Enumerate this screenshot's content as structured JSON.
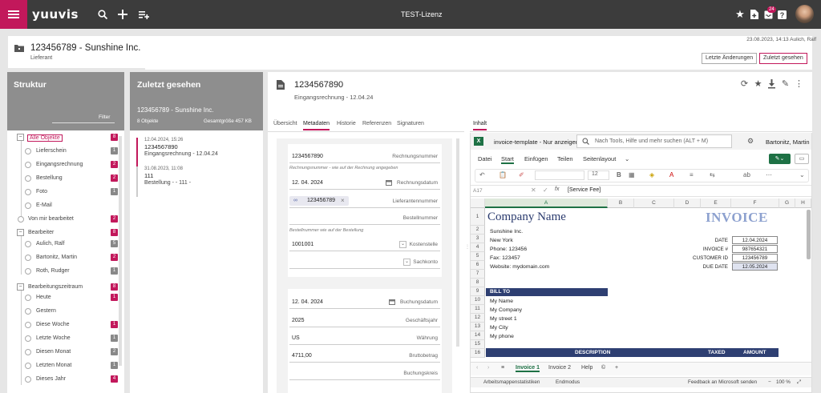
{
  "app": {
    "logo": "yuuvis",
    "title": "TEST-Lizenz",
    "notif_count": "24"
  },
  "header": {
    "object_title": "123456789 - Sunshine Inc.",
    "object_subtitle": "Lieferant",
    "meta": "23.08.2023, 14:13 Aulich, Ralf",
    "btn_recent_changes": "Letzte Änderungen",
    "btn_recently_seen": "Zuletzt gesehen"
  },
  "struktur": {
    "title": "Struktur",
    "filter": "Filter",
    "items": [
      {
        "label": "Alle Objekte",
        "count": "8",
        "color": "pink"
      },
      {
        "label": "Lieferschein",
        "count": "1",
        "color": "gray"
      },
      {
        "label": "Eingangsrechnung",
        "count": "2",
        "color": "pink"
      },
      {
        "label": "Bestellung",
        "count": "2",
        "color": "pink"
      },
      {
        "label": "Foto",
        "count": "1",
        "color": "gray"
      },
      {
        "label": "E-Mail",
        "count": "",
        "color": "gray"
      },
      {
        "label": "Von mir bearbeitet",
        "count": "2",
        "color": "pink"
      },
      {
        "label": "Bearbeiter",
        "count": "8",
        "color": "pink"
      },
      {
        "label": "Aulich, Ralf",
        "count": "5",
        "color": "gray"
      },
      {
        "label": "Bartonitz, Martin",
        "count": "2",
        "color": "pink"
      },
      {
        "label": "Roth, Rudger",
        "count": "1",
        "color": "gray"
      },
      {
        "label": "Bearbeitungszeitraum",
        "count": "8",
        "color": "pink"
      },
      {
        "label": "Heute",
        "count": "1",
        "color": "pink"
      },
      {
        "label": "Gestern",
        "count": "",
        "color": "gray"
      },
      {
        "label": "Diese Woche",
        "count": "1",
        "color": "pink"
      },
      {
        "label": "Letzte Woche",
        "count": "1",
        "color": "gray"
      },
      {
        "label": "Diesen Monat",
        "count": "2",
        "color": "gray"
      },
      {
        "label": "Letzten Monat",
        "count": "1",
        "color": "gray"
      },
      {
        "label": "Dieses Jahr",
        "count": "4",
        "color": "pink"
      }
    ]
  },
  "zuletzt": {
    "title": "Zuletzt gesehen",
    "entity": "123456789 - Sunshine Inc.",
    "count": "8 Objekte",
    "size": "Gesamtgröße 457 KB",
    "items": [
      {
        "date": "12.04.2024, 15:26",
        "title": "1234567890",
        "sub": "Eingangsrechnung - 12.04.24"
      },
      {
        "date": "31.08.2023, 11:08",
        "title": "111",
        "sub": "Bestellung - - 111 -"
      }
    ]
  },
  "document": {
    "title": "1234567890",
    "subtitle": "Eingangsrechnung - 12.04.24",
    "tabs": [
      "Übersicht",
      "Metadaten",
      "Historie",
      "Referenzen",
      "Signaturen"
    ],
    "content_tab": "Inhalt"
  },
  "metadata": {
    "rechnungsnummer_value": "1234567890",
    "rechnungsnummer_label": "Rechnungsnummer",
    "rechnungsnummer_hint": "Rechnungsnummer - wie auf der Rechnung angegeben",
    "rechnungsdatum_value": "12. 04. 2024",
    "rechnungsdatum_label": "Rechnungsdatum",
    "lieferantennummer_chip": "123456789",
    "lieferantennummer_label": "Lieferantennummer",
    "bestellnummer_label": "Bestellnummer",
    "bestellnummer_hint": "Bestellnummer wie auf der Bestellung",
    "kostenstelle_value": "1001001",
    "kostenstelle_label": "Kostenstelle",
    "sachkonto_label": "Sachkonto",
    "buchungsdatum_value": "12. 04. 2024",
    "buchungsdatum_label": "Buchungsdatum",
    "geschaeftsjahr_value": "2025",
    "geschaeftsjahr_label": "Geschäftsjahr",
    "waehrung_value": "US",
    "waehrung_label": "Währung",
    "bruttobetrag_value": "4711,00",
    "bruttobetrag_label": "Bruttobetrag",
    "buchungskreis_label": "Buchungskreis"
  },
  "excel": {
    "filename": "invoice-template  -  Nur anzeigen",
    "search_placeholder": "Nach Tools, Hilfe und mehr suchen (ALT + M)",
    "user": "Bartonitz, Martin",
    "menu": [
      "Datei",
      "Start",
      "Einfügen",
      "Teilen",
      "Seitenlayout"
    ],
    "font_size": "12",
    "cell_ref": "A17",
    "formula": "[Service Fee]",
    "columns": [
      "A",
      "B",
      "C",
      "D",
      "E",
      "F",
      "G",
      "H"
    ],
    "rows": [
      "1",
      "2",
      "3",
      "4",
      "5",
      "6",
      "7",
      "8",
      "9",
      "10",
      "11",
      "12",
      "13",
      "14",
      "15",
      "16"
    ],
    "company_name": "Company Name",
    "invoice_word": "INVOICE",
    "company_lines": [
      "Sunshine Inc.",
      "New York",
      "Phone: 123456",
      "Fax: 123457",
      "Website: mydomain.com"
    ],
    "kv": [
      {
        "label": "DATE",
        "value": "12.04.2024"
      },
      {
        "label": "INVOICE #",
        "value": "987654321"
      },
      {
        "label": "CUSTOMER ID",
        "value": "123456789"
      },
      {
        "label": "DUE DATE",
        "value": "12.05.2024"
      }
    ],
    "bill_to": "BILL TO",
    "bill_lines": [
      "My Name",
      "My Company",
      "My street 1",
      "My City",
      "My phone"
    ],
    "desc_header": "DESCRIPTION",
    "taxed_header": "TAXED",
    "amount_header": "AMOUNT",
    "sheets": [
      "Invoice 1",
      "Invoice 2",
      "Help"
    ],
    "status_left": "Arbeitsmappenstatistiken",
    "status_mid": "Endmodus",
    "status_feedback": "Feedback an Microsoft senden",
    "zoom": "100 %"
  }
}
